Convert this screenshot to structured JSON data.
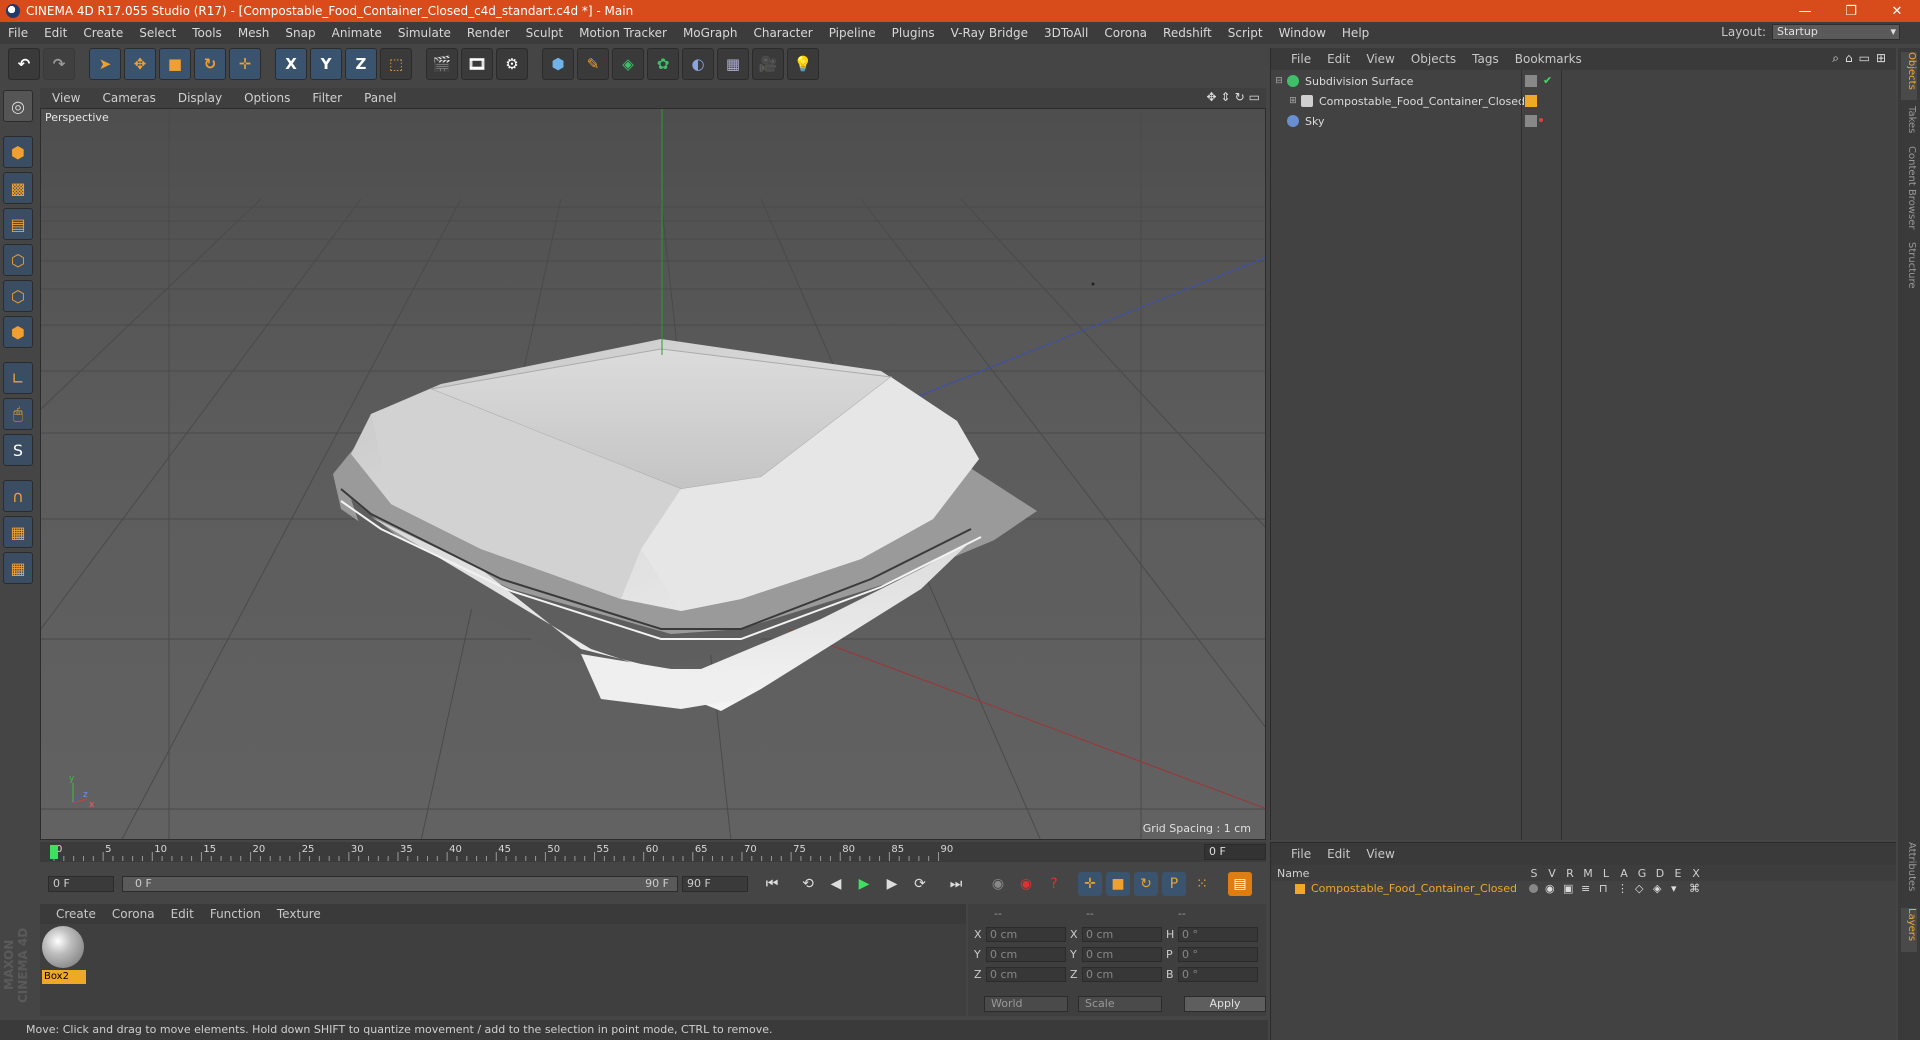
{
  "window": {
    "title": "CINEMA 4D R17.055 Studio (R17) - [Compostable_Food_Container_Closed_c4d_standart.c4d *] - Main",
    "controls": [
      "—",
      "❐",
      "✕"
    ]
  },
  "menubar": {
    "items": [
      "File",
      "Edit",
      "Create",
      "Select",
      "Tools",
      "Mesh",
      "Snap",
      "Animate",
      "Simulate",
      "Render",
      "Sculpt",
      "Motion Tracker",
      "MoGraph",
      "Character",
      "Pipeline",
      "Plugins",
      "V-Ray Bridge",
      "3DToAll",
      "Corona",
      "Redshift",
      "Script",
      "Window",
      "Help"
    ],
    "layout_label": "Layout:",
    "layout_value": "Startup"
  },
  "toolbar": {
    "axis_x": "X",
    "axis_y": "Y",
    "axis_z": "Z"
  },
  "viewport": {
    "menu": [
      "View",
      "Cameras",
      "Display",
      "Options",
      "Filter",
      "Panel"
    ],
    "camera_label": "Perspective",
    "grid_spacing": "Grid Spacing : 1 cm",
    "axis_labels": [
      "y",
      "z",
      "x"
    ]
  },
  "timeline": {
    "ticks": [
      "0",
      "5",
      "10",
      "15",
      "20",
      "25",
      "30",
      "35",
      "40",
      "45",
      "50",
      "55",
      "60",
      "65",
      "70",
      "75",
      "80",
      "85",
      "90"
    ],
    "current_frame": "0 F"
  },
  "playbar": {
    "start_field": "0 F",
    "range_start": "0 F",
    "range_end": "90 F",
    "end_field": "90 F"
  },
  "material_panel": {
    "menu": [
      "Create",
      "Corona",
      "Edit",
      "Function",
      "Texture"
    ],
    "materials": [
      {
        "name": "Box2"
      }
    ]
  },
  "coordinates": {
    "headers": [
      "--",
      "--",
      "--"
    ],
    "rows": [
      {
        "a": "X",
        "av": "0 cm",
        "b": "X",
        "bv": "0 cm",
        "c": "H",
        "cv": "0 °"
      },
      {
        "a": "Y",
        "av": "0 cm",
        "b": "Y",
        "bv": "0 cm",
        "c": "P",
        "cv": "0 °"
      },
      {
        "a": "Z",
        "av": "0 cm",
        "b": "Z",
        "bv": "0 cm",
        "c": "B",
        "cv": "0 °"
      }
    ],
    "space": "World",
    "mode": "Scale",
    "apply": "Apply"
  },
  "status": {
    "text": "Move: Click and drag to move elements. Hold down SHIFT to quantize movement / add to the selection in point mode, CTRL to remove."
  },
  "objects_panel": {
    "menu": [
      "File",
      "Edit",
      "View",
      "Objects",
      "Tags",
      "Bookmarks"
    ],
    "objects": [
      {
        "name": "Subdivision Surface",
        "color": "#3fbf6a"
      },
      {
        "name": "Compostable_Food_Container_Closed",
        "color": "#cfcfcf"
      },
      {
        "name": "Sky",
        "color": "#6a8fd0"
      }
    ]
  },
  "layers_panel": {
    "menu": [
      "File",
      "Edit",
      "View"
    ],
    "columns": [
      "Name",
      "S",
      "V",
      "R",
      "M",
      "L",
      "A",
      "G",
      "D",
      "E",
      "X"
    ],
    "layers": [
      {
        "name": "Compostable_Food_Container_Closed",
        "color": "#f0a828"
      }
    ]
  },
  "right_tabs": [
    "Objects",
    "Takes",
    "Content Browser",
    "Structure",
    "Attributes",
    "Layers"
  ],
  "logo": "MAXON CINEMA 4D"
}
